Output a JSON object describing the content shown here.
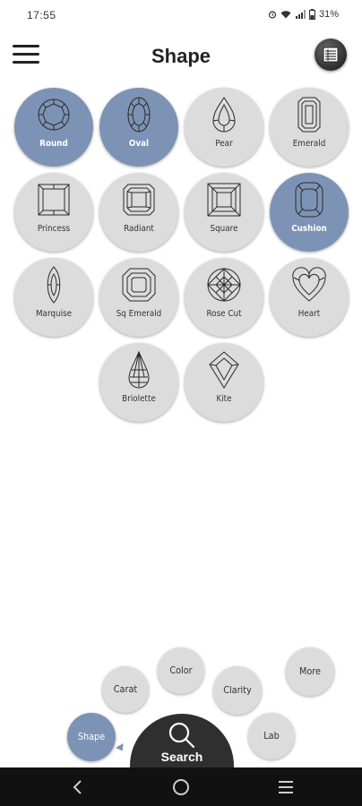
{
  "status_bar": {
    "time": "17:55",
    "battery": "31%",
    "icons": [
      "alarm-icon",
      "wifi-icon",
      "signal-icon",
      "battery-icon"
    ]
  },
  "header": {
    "title": "Shape",
    "menu_icon": "hamburger-menu-icon",
    "list_icon": "list-view-icon"
  },
  "colors": {
    "selected": "#7d93b6",
    "unselected": "#dcdcdc",
    "dark": "#2f2f2f"
  },
  "shapes": [
    {
      "label": "Round",
      "selected": true,
      "icon": "round-diamond-icon"
    },
    {
      "label": "Oval",
      "selected": true,
      "icon": "oval-diamond-icon"
    },
    {
      "label": "Pear",
      "selected": false,
      "icon": "pear-diamond-icon"
    },
    {
      "label": "Emerald",
      "selected": false,
      "icon": "emerald-diamond-icon"
    },
    {
      "label": "Princess",
      "selected": false,
      "icon": "princess-diamond-icon"
    },
    {
      "label": "Radiant",
      "selected": false,
      "icon": "radiant-diamond-icon"
    },
    {
      "label": "Square",
      "selected": false,
      "icon": "square-diamond-icon"
    },
    {
      "label": "Cushion",
      "selected": true,
      "icon": "cushion-diamond-icon"
    },
    {
      "label": "Marquise",
      "selected": false,
      "icon": "marquise-diamond-icon"
    },
    {
      "label": "Sq Emerald",
      "selected": false,
      "icon": "sq-emerald-diamond-icon"
    },
    {
      "label": "Rose Cut",
      "selected": false,
      "icon": "rose-cut-diamond-icon"
    },
    {
      "label": "Heart",
      "selected": false,
      "icon": "heart-diamond-icon"
    },
    {
      "label": "Briolette",
      "selected": false,
      "icon": "briolette-diamond-icon"
    },
    {
      "label": "Kite",
      "selected": false,
      "icon": "kite-diamond-icon"
    }
  ],
  "bottom_menu": {
    "shape": "Shape",
    "carat": "Carat",
    "color": "Color",
    "clarity": "Clarity",
    "more": "More",
    "lab": "Lab",
    "search": "Search"
  }
}
